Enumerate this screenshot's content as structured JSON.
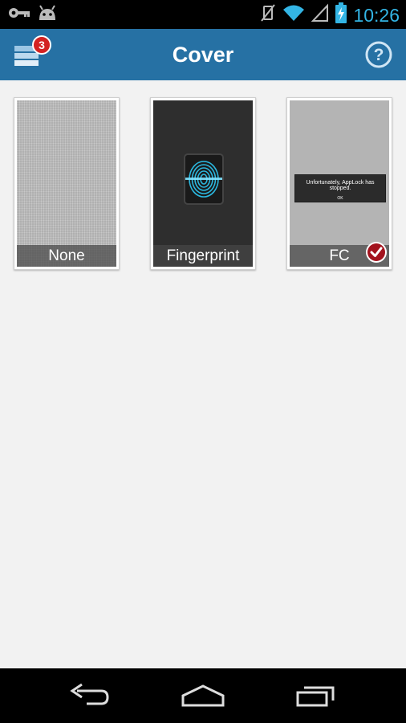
{
  "status_bar": {
    "time": "10:26",
    "icons": [
      "key-icon",
      "android-icon",
      "vibrate-off-icon",
      "wifi-icon",
      "no-signal-icon",
      "battery-charging-icon"
    ],
    "accent_color": "#33b5e5"
  },
  "action_bar": {
    "title": "Cover",
    "menu_badge": "3",
    "menu_icon": "drawer-stack-icon",
    "help_icon": "help-icon",
    "color": "#2671a4"
  },
  "covers": [
    {
      "label": "None"
    },
    {
      "label": "Fingerprint"
    },
    {
      "label": "FC",
      "selected": true,
      "dialog_message": "Unfortunately, AppLock has stopped.",
      "dialog_button": "OK"
    }
  ],
  "nav_bar": {
    "icons": [
      "back-icon",
      "home-icon",
      "recent-apps-icon"
    ]
  }
}
